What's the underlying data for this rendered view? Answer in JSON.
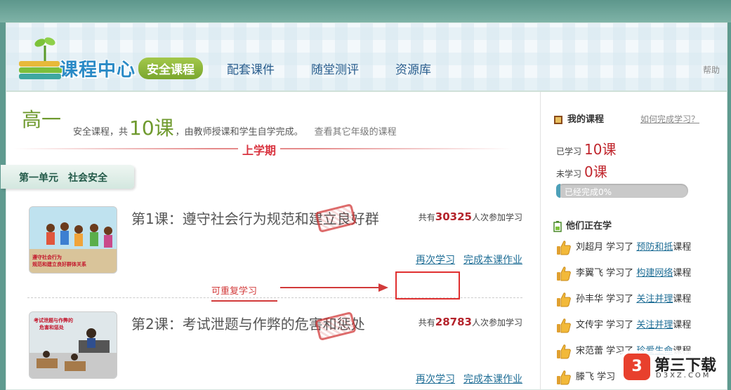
{
  "header": {
    "logo_text": "课程中心",
    "nav": [
      "安全课程",
      "配套课件",
      "随堂测评",
      "资源库"
    ],
    "help": "帮助"
  },
  "intro": {
    "grade": "高一",
    "pre": "安全课程，共",
    "count": "10课",
    "post": "，由教师授课和学生自学完成。",
    "other_grades": "查看其它年级的课程"
  },
  "term": "上学期",
  "unit": "第一单元　社会安全",
  "lessons": [
    {
      "title": "第1课：遵守社会行为规范和建立良好群",
      "count_pre": "共有",
      "count": "30325",
      "count_post": "人次参加学习",
      "relearn": "再次学习",
      "homework": "完成本课作业",
      "thumb_caption": "遵守社会行为规范和建立良好群体关系"
    },
    {
      "title": "第2课：考试泄题与作弊的危害和惩处",
      "count_pre": "共有",
      "count": "28783",
      "count_post": "人次参加学习",
      "relearn": "再次学习",
      "homework": "完成本课作业",
      "thumb_caption": "考试泄题与作弊的危害和惩处"
    }
  ],
  "annotation": "可重复学习",
  "sidebar": {
    "my_courses": "我的课程",
    "how_to": "如何完成学习？",
    "studied_label": "已学习",
    "studied": "10课",
    "unstudied_label": "未学习",
    "unstudied": "0课",
    "progress_text": "已经完成0%",
    "progress_fraction": 0.03,
    "learners_title": "他们正在学",
    "learners": [
      {
        "name": "刘超月",
        "verb": "学习了",
        "course": "预防和抵",
        "suffix": "课程"
      },
      {
        "name": "李翼飞",
        "verb": "学习了",
        "course": "构建网络",
        "suffix": "课程"
      },
      {
        "name": "孙丰华",
        "verb": "学习了",
        "course": "关注并理",
        "suffix": "课程"
      },
      {
        "name": "文传宇",
        "verb": "学习了",
        "course": "关注并理",
        "suffix": "课程"
      },
      {
        "name": "宋范蕾",
        "verb": "学习了",
        "course": "珍爱生命",
        "suffix": "课程"
      },
      {
        "name": "滕飞",
        "verb": "学习",
        "course": "",
        "suffix": ""
      }
    ]
  },
  "watermark": {
    "name": "第三下载",
    "sub": "D3XZ.COM"
  },
  "colors": {
    "accent_green": "#6f9a2f",
    "red": "#d9333f",
    "link": "#1f6e96",
    "nav_active": "#8cb83a"
  }
}
